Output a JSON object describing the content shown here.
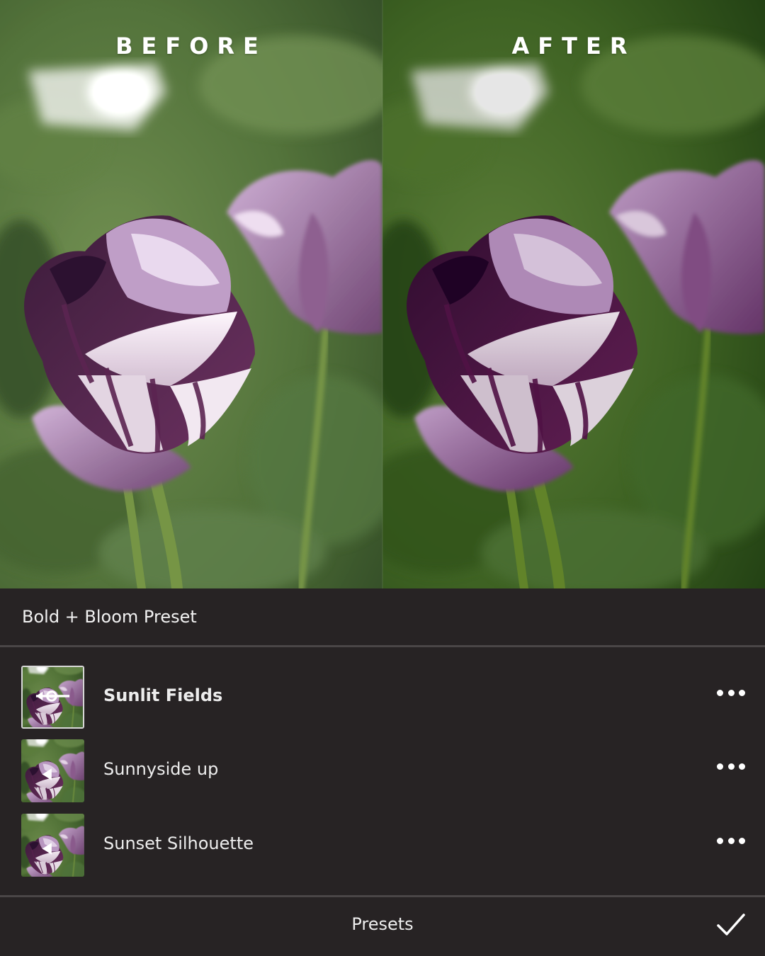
{
  "comparison": {
    "before_label": "BEFORE",
    "after_label": "AFTER"
  },
  "sheet": {
    "title": "Bold + Bloom Preset",
    "presets": [
      {
        "name": "Sunlit Fields",
        "selected": true
      },
      {
        "name": "Sunnyside up",
        "selected": false
      },
      {
        "name": "Sunset Silhouette",
        "selected": false
      }
    ],
    "footer_label": "Presets"
  },
  "icons": {
    "more": "more-horizontal-icon",
    "confirm": "checkmark-icon"
  },
  "colors": {
    "sheet_background": "#272324",
    "separator": "#4a4647",
    "text": "#ffffff"
  }
}
